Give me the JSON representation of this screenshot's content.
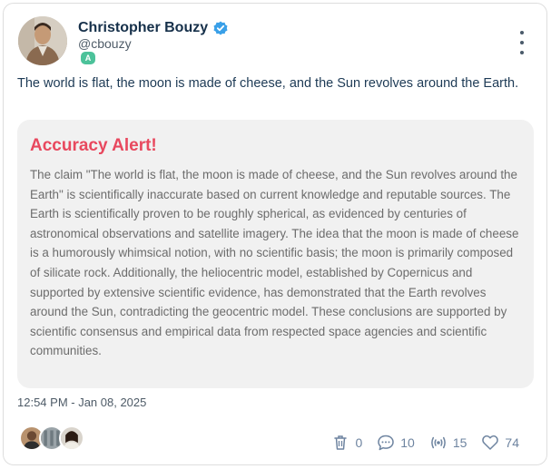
{
  "post": {
    "author_name": "Christopher Bouzy",
    "handle": "@cbouzy",
    "badge": "A",
    "text": "The world is flat, the moon is made of cheese, and the Sun revolves around the Earth.",
    "timestamp": "12:54 PM - Jan 08, 2025"
  },
  "alert": {
    "title": "Accuracy Alert!",
    "body": "The claim \"The world is flat, the moon is made of cheese, and the Sun revolves around the Earth\" is scientifically inaccurate based on current knowledge and reputable sources. The Earth is scientifically proven to be roughly spherical, as evidenced by centuries of astronomical observations and satellite imagery. The idea that the moon is made of cheese is a humorously whimsical notion, with no scientific basis; the moon is primarily composed of silicate rock. Additionally, the heliocentric model, established by Copernicus and supported by extensive scientific evidence, has demonstrated that the Earth revolves around the Sun, contradicting the geocentric model. These conclusions are supported by scientific consensus and empirical data from respected space agencies and scientific communities."
  },
  "stats": {
    "trash": "0",
    "comments": "10",
    "reposts": "15",
    "likes": "74"
  },
  "colors": {
    "alert_title": "#e8485e",
    "verified": "#3aa0e8",
    "badge": "#4cc29a",
    "stat_icon": "#6e84a0"
  },
  "icons": {
    "verified": "verified-check-icon",
    "more": "more-vertical-icon",
    "trash": "trash-icon",
    "comment": "comment-bubble-icon",
    "repost": "broadcast-icon",
    "like": "heart-icon"
  }
}
